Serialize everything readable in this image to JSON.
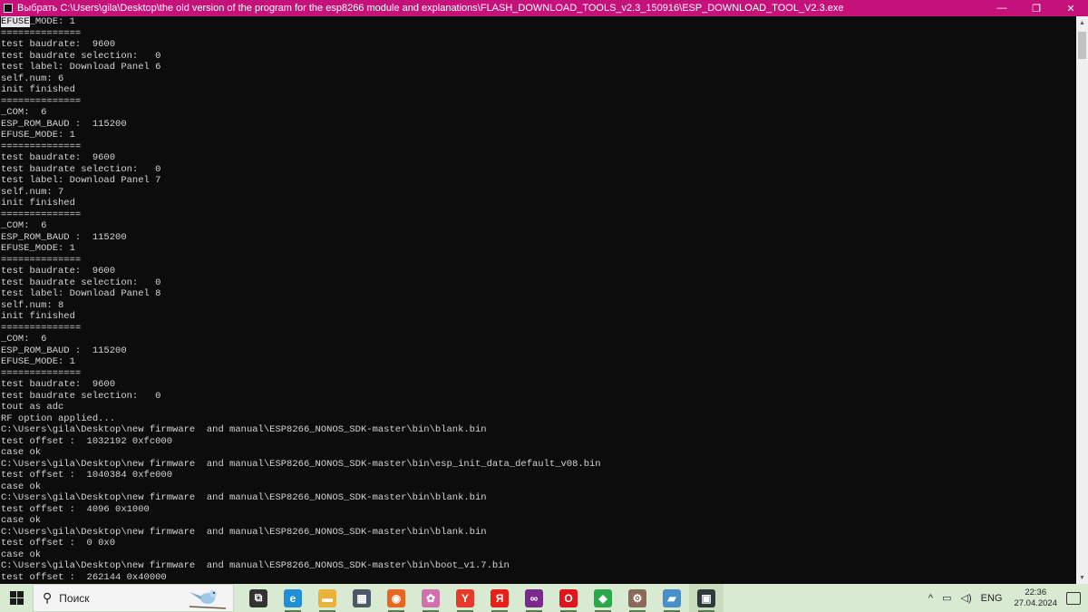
{
  "window": {
    "title": "Выбрать C:\\Users\\gila\\Desktop\\the old version of the program for the esp8266 module and explanations\\FLASH_DOWNLOAD_TOOLS_v2.3_150916\\ESP_DOWNLOAD_TOOL_V2.3.exe",
    "minimize_glyph": "—",
    "maximize_glyph": "❐",
    "close_glyph": "✕"
  },
  "console": {
    "selected_text": "EFUSE",
    "first_line_rest": "_MODE: 1",
    "lines": [
      "==============",
      "test baudrate:  9600",
      "test baudrate selection:   0",
      "test label: Download Panel 6",
      "self.num: 6",
      "init finished",
      "==============",
      "_COM:  6",
      "ESP_ROM_BAUD :  115200",
      "EFUSE_MODE: 1",
      "==============",
      "test baudrate:  9600",
      "test baudrate selection:   0",
      "test label: Download Panel 7",
      "self.num: 7",
      "init finished",
      "==============",
      "_COM:  6",
      "ESP_ROM_BAUD :  115200",
      "EFUSE_MODE: 1",
      "==============",
      "test baudrate:  9600",
      "test baudrate selection:   0",
      "test label: Download Panel 8",
      "self.num: 8",
      "init finished",
      "==============",
      "_COM:  6",
      "ESP_ROM_BAUD :  115200",
      "EFUSE_MODE: 1",
      "==============",
      "test baudrate:  9600",
      "test baudrate selection:   0",
      "tout as adc",
      "RF option applied...",
      "C:\\Users\\gila\\Desktop\\new firmware  and manual\\ESP8266_NONOS_SDK-master\\bin\\blank.bin",
      "test offset :  1032192 0xfc000",
      "case ok",
      "C:\\Users\\gila\\Desktop\\new firmware  and manual\\ESP8266_NONOS_SDK-master\\bin\\esp_init_data_default_v08.bin",
      "test offset :  1040384 0xfe000",
      "case ok",
      "C:\\Users\\gila\\Desktop\\new firmware  and manual\\ESP8266_NONOS_SDK-master\\bin\\blank.bin",
      "test offset :  4096 0x1000",
      "case ok",
      "C:\\Users\\gila\\Desktop\\new firmware  and manual\\ESP8266_NONOS_SDK-master\\bin\\blank.bin",
      "test offset :  0 0x0",
      "case ok",
      "C:\\Users\\gila\\Desktop\\new firmware  and manual\\ESP8266_NONOS_SDK-master\\bin\\boot_v1.7.bin",
      "test offset :  262144 0x40000"
    ]
  },
  "taskbar": {
    "search_placeholder": "Поиск",
    "apps": [
      {
        "name": "task-view-icon",
        "glyph": "⧉",
        "color": "#333333"
      },
      {
        "name": "edge-icon",
        "glyph": "e",
        "color": "#1f8fd6"
      },
      {
        "name": "file-explorer-icon",
        "glyph": "▬",
        "color": "#e8b33a"
      },
      {
        "name": "calculator-icon",
        "glyph": "▦",
        "color": "#4a5a68"
      },
      {
        "name": "firefox-icon",
        "glyph": "◉",
        "color": "#e8661f"
      },
      {
        "name": "paint-icon",
        "glyph": "✿",
        "color": "#d070b0"
      },
      {
        "name": "yandex-browser-icon",
        "glyph": "Y",
        "color": "#e83a2a"
      },
      {
        "name": "yandex-icon",
        "glyph": "Я",
        "color": "#e8201a"
      },
      {
        "name": "app-glasses-icon",
        "glyph": "∞",
        "color": "#7a2a8a"
      },
      {
        "name": "opera-icon",
        "glyph": "O",
        "color": "#e0161f"
      },
      {
        "name": "green-cube-icon",
        "glyph": "◆",
        "color": "#2aa84a"
      },
      {
        "name": "network-tool-icon",
        "glyph": "⚙",
        "color": "#8a6a5a"
      },
      {
        "name": "folder-app-icon",
        "glyph": "▰",
        "color": "#4a90c8"
      },
      {
        "name": "console-app-icon",
        "glyph": "▣",
        "color": "#2f3a3a"
      }
    ],
    "tray": {
      "chevron": "^",
      "network": "▭",
      "volume": "◁)",
      "language": "ENG",
      "time": "22:36",
      "date": "27.04.2024"
    }
  }
}
